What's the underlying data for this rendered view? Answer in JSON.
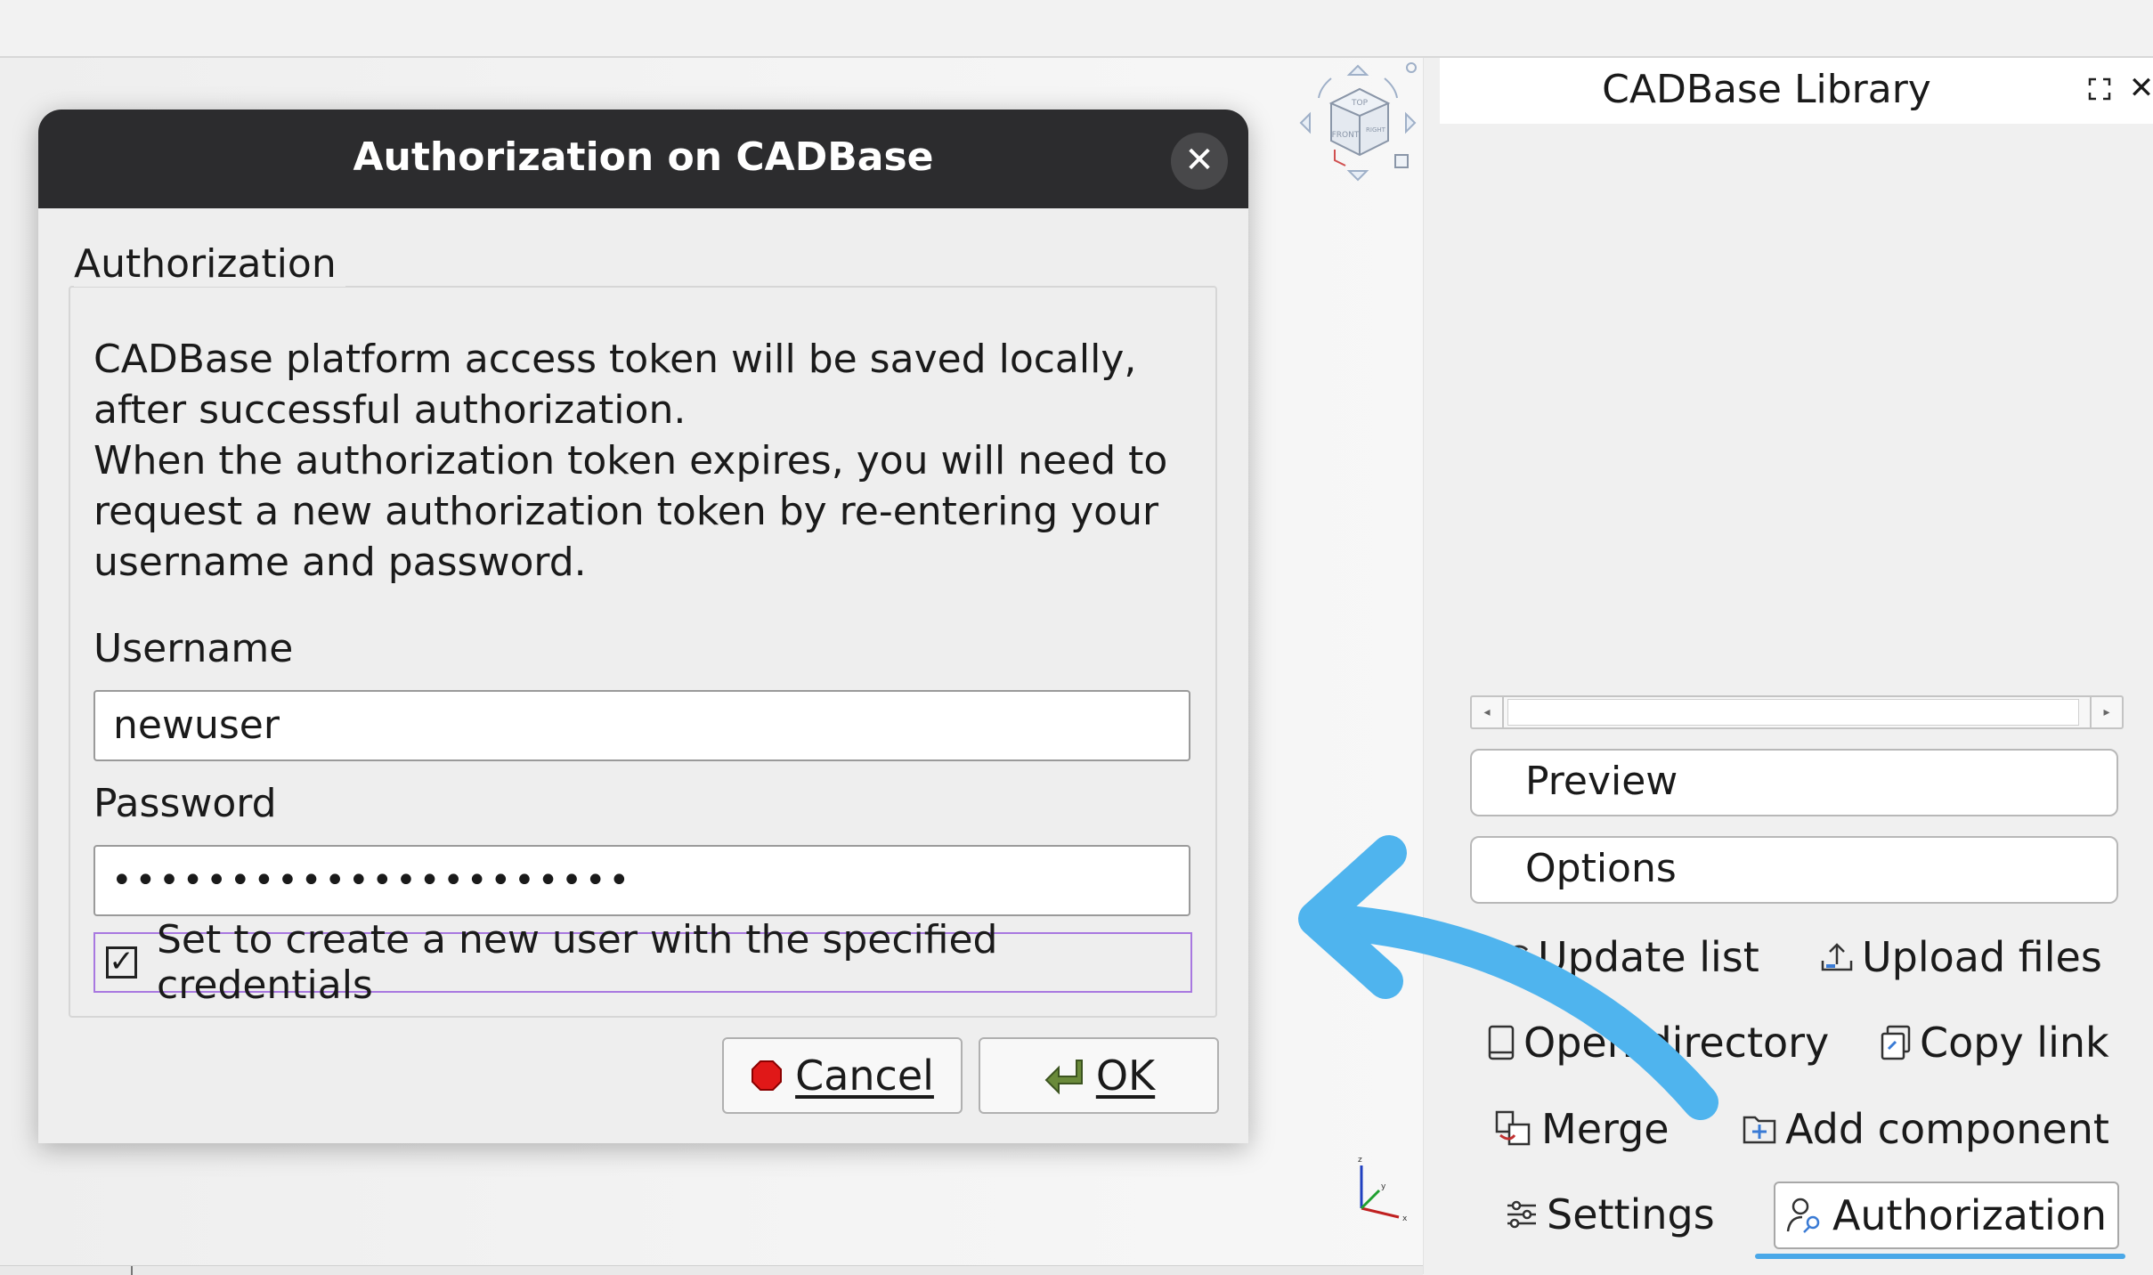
{
  "panel": {
    "title": "CADBase Library",
    "preview_label": "Preview",
    "options_label": "Options",
    "tools": {
      "update_list": "Update list",
      "upload_files": "Upload files",
      "open_directory": "Open directory",
      "copy_link": "Copy link",
      "merge": "Merge",
      "add_component": "Add component",
      "settings": "Settings",
      "authorization": "Authorization"
    }
  },
  "dialog": {
    "title": "Authorization on CADBase",
    "group_title": "Authorization",
    "info_text": "CADBase platform access token will be saved locally,\nafter successful authorization.\nWhen the authorization token expires, you will need to\nrequest a new authorization token by re-entering your\nusername and password.",
    "username_label": "Username",
    "username_value": "newuser",
    "password_label": "Password",
    "password_value": "••••••••••••••••••••••",
    "checkbox_label": "Set to create a new user with the specified credentials",
    "checkbox_checked": true,
    "cancel_label": "Cancel",
    "ok_label": "OK"
  },
  "navcube": {
    "faces": [
      "TOP",
      "FRONT",
      "RIGHT"
    ]
  },
  "colors": {
    "annotation_arrow": "#4fb4ee",
    "titlebar": "#2c2c2e",
    "accent_underline": "#4aa8e8",
    "checkbox_focus": "#a878e0"
  }
}
